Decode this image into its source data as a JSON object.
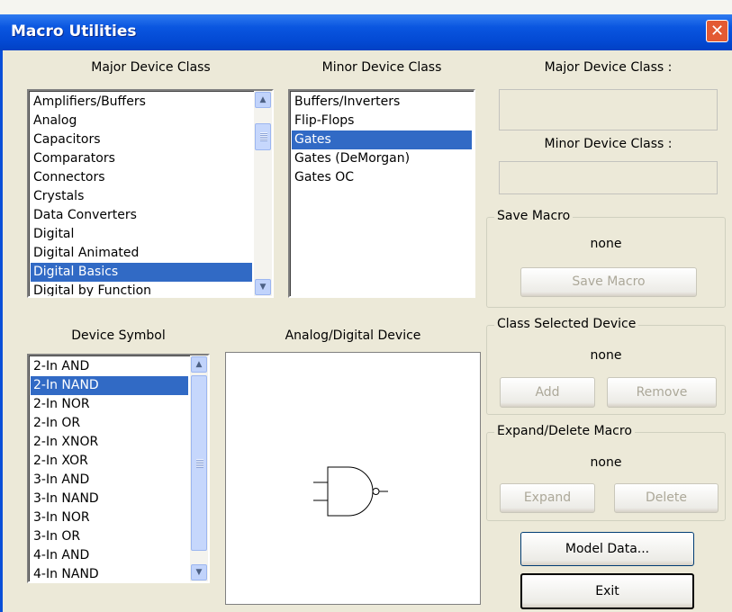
{
  "window": {
    "title": "Macro Utilities",
    "close_glyph": "✕"
  },
  "labels": {
    "major_device_class": "Major Device Class",
    "minor_device_class": "Minor Device Class",
    "major_device_class_field": "Major Device Class :",
    "minor_device_class_field": "Minor Device Class :",
    "device_symbol": "Device Symbol",
    "analog_digital_device": "Analog/Digital Device"
  },
  "major_list": {
    "items": [
      "Amplifiers/Buffers",
      "Analog",
      "Capacitors",
      "Comparators",
      "Connectors",
      "Crystals",
      "Data Converters",
      "Digital",
      "Digital Animated",
      "Digital Basics",
      "Digital by Function"
    ],
    "selected": "Digital Basics"
  },
  "minor_list": {
    "items": [
      "Buffers/Inverters",
      "Flip-Flops",
      "Gates",
      "Gates (DeMorgan)",
      "Gates OC"
    ],
    "selected": "Gates"
  },
  "symbol_list": {
    "items": [
      "2-In AND",
      "2-In NAND",
      "2-In NOR",
      "2-In OR",
      "2-In XNOR",
      "2-In XOR",
      "3-In AND",
      "3-In NAND",
      "3-In NOR",
      "3-In OR",
      "4-In AND",
      "4-In NAND"
    ],
    "selected": "2-In NAND"
  },
  "save_macro": {
    "legend": "Save Macro",
    "value": "none",
    "button": "Save Macro"
  },
  "class_selected_device": {
    "legend": "Class Selected Device",
    "value": "none",
    "add": "Add",
    "remove": "Remove"
  },
  "expand_delete_macro": {
    "legend": "Expand/Delete Macro",
    "value": "none",
    "expand": "Expand",
    "delete": "Delete"
  },
  "buttons": {
    "model_data": "Model Data...",
    "exit": "Exit"
  },
  "icons": {
    "scroll_up": "▲",
    "scroll_down": "▼"
  },
  "colors": {
    "title_bar": "#0349d3",
    "selection": "#316ac5",
    "dialog_face": "#ece9d8",
    "close_button": "#e35a33"
  }
}
